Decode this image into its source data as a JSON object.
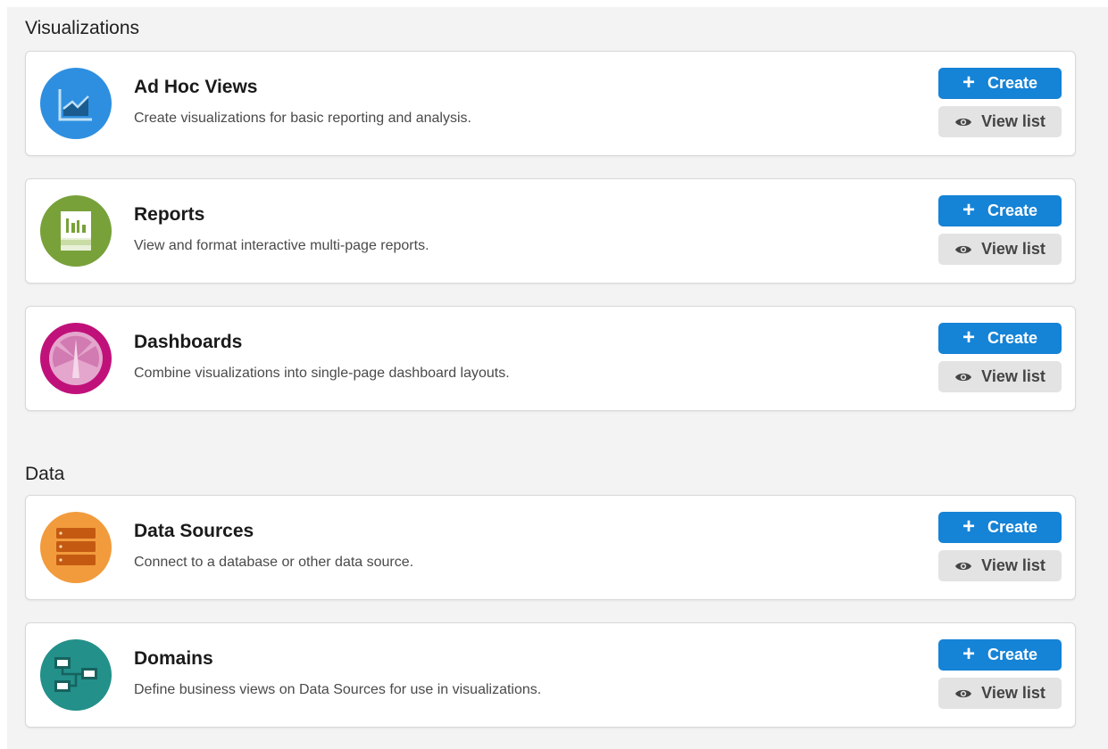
{
  "sections": [
    {
      "title": "Visualizations",
      "cards": [
        {
          "title": "Ad Hoc Views",
          "description": "Create visualizations for basic reporting and analysis.",
          "icon": "line-chart-icon",
          "color": "#2e8fe0",
          "create_label": "Create",
          "view_label": "View list"
        },
        {
          "title": "Reports",
          "description": "View and format interactive multi-page reports.",
          "icon": "report-icon",
          "color": "#78a13a",
          "create_label": "Create",
          "view_label": "View list"
        },
        {
          "title": "Dashboards",
          "description": "Combine visualizations into single-page dashboard layouts.",
          "icon": "gauge-icon",
          "color": "#c0117a",
          "create_label": "Create",
          "view_label": "View list"
        }
      ]
    },
    {
      "title": "Data",
      "cards": [
        {
          "title": "Data Sources",
          "description": "Connect to a database or other data source.",
          "icon": "database-icon",
          "color": "#f29b3c",
          "create_label": "Create",
          "view_label": "View list"
        },
        {
          "title": "Domains",
          "description": "Define business views on Data Sources for use in visualizations.",
          "icon": "domain-diagram-icon",
          "color": "#23908a",
          "create_label": "Create",
          "view_label": "View list"
        }
      ]
    }
  ],
  "colors": {
    "primary_button": "#1583d6",
    "secondary_button": "#e3e3e3",
    "background": "#f3f3f3"
  }
}
